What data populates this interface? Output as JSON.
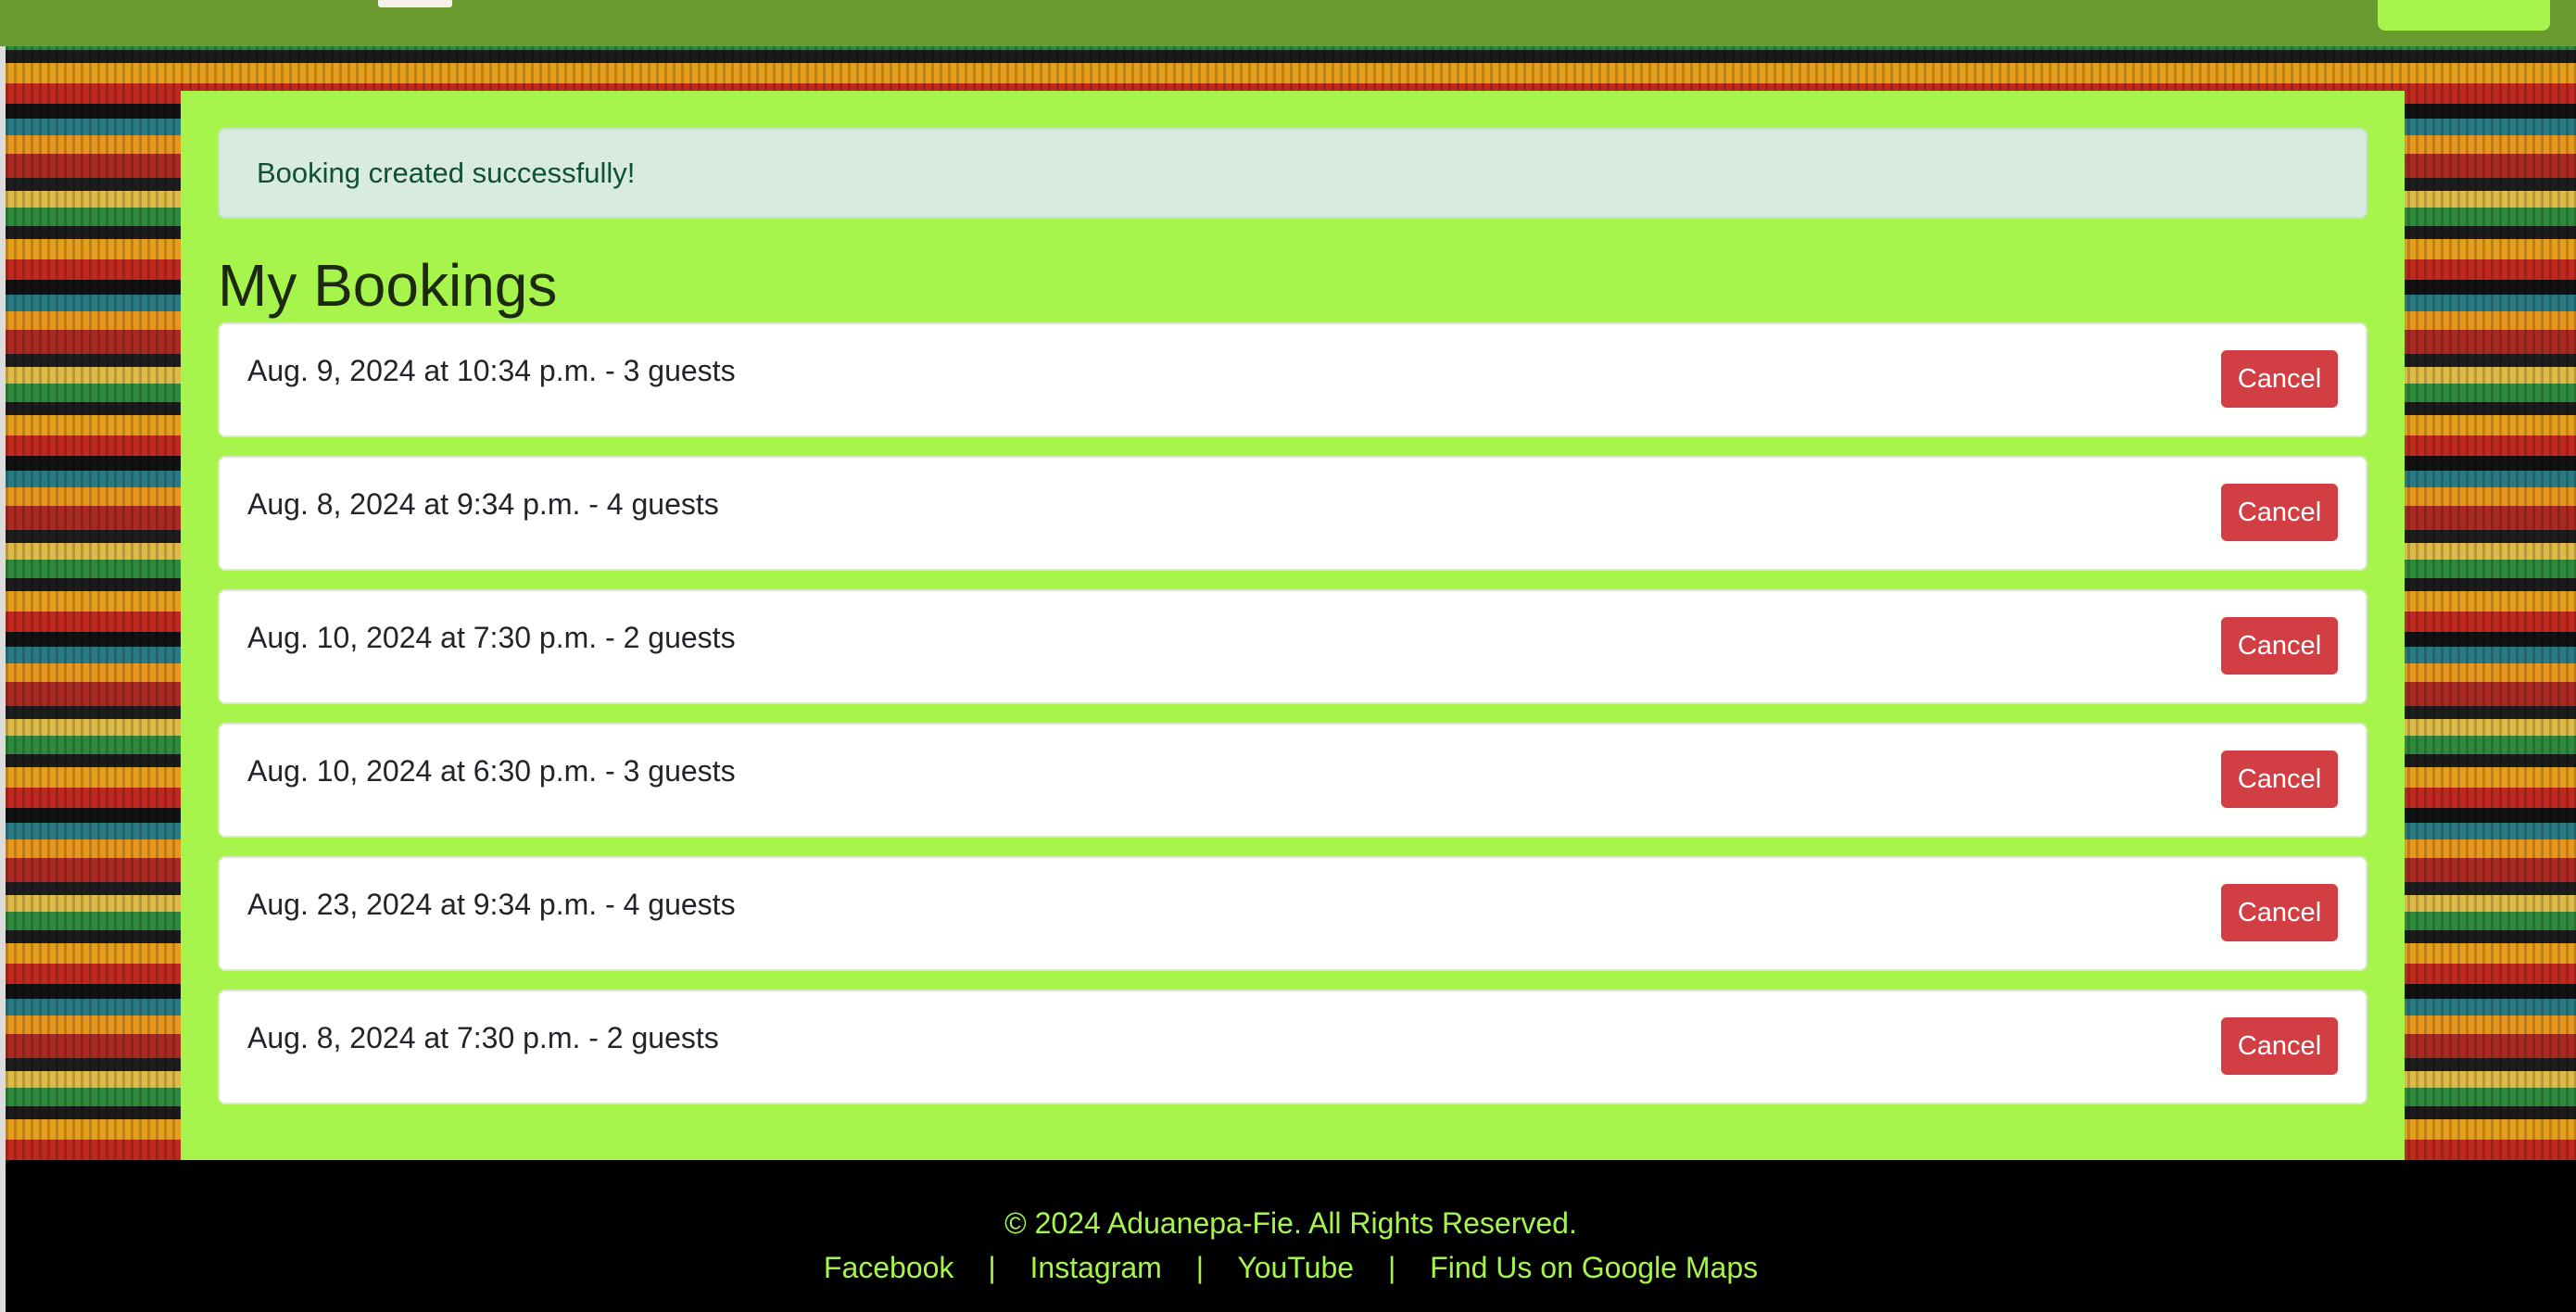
{
  "alert": {
    "message": "Booking created successfully!"
  },
  "page": {
    "title": "My Bookings"
  },
  "bookings": [
    {
      "text": "Aug. 9, 2024 at 10:34 p.m. - 3 guests",
      "action": "Cancel"
    },
    {
      "text": "Aug. 8, 2024 at 9:34 p.m. - 4 guests",
      "action": "Cancel"
    },
    {
      "text": "Aug. 10, 2024 at 7:30 p.m. - 2 guests",
      "action": "Cancel"
    },
    {
      "text": "Aug. 10, 2024 at 6:30 p.m. - 3 guests",
      "action": "Cancel"
    },
    {
      "text": "Aug. 23, 2024 at 9:34 p.m. - 4 guests",
      "action": "Cancel"
    },
    {
      "text": "Aug. 8, 2024 at 7:30 p.m. - 2 guests",
      "action": "Cancel"
    }
  ],
  "footer": {
    "copyright": "© 2024 Aduanepa-Fie. All Rights Reserved.",
    "separator": "|",
    "links": [
      "Facebook",
      "Instagram",
      "YouTube",
      "Find Us on Google Maps"
    ]
  },
  "colors": {
    "navbar": "#6a9a30",
    "container": "#a6f44c",
    "alert_bg": "#d8ebde",
    "alert_text": "#0f5132",
    "cancel_button": "#d13f45",
    "footer_bg": "#000000",
    "footer_text": "#a6f44c"
  }
}
